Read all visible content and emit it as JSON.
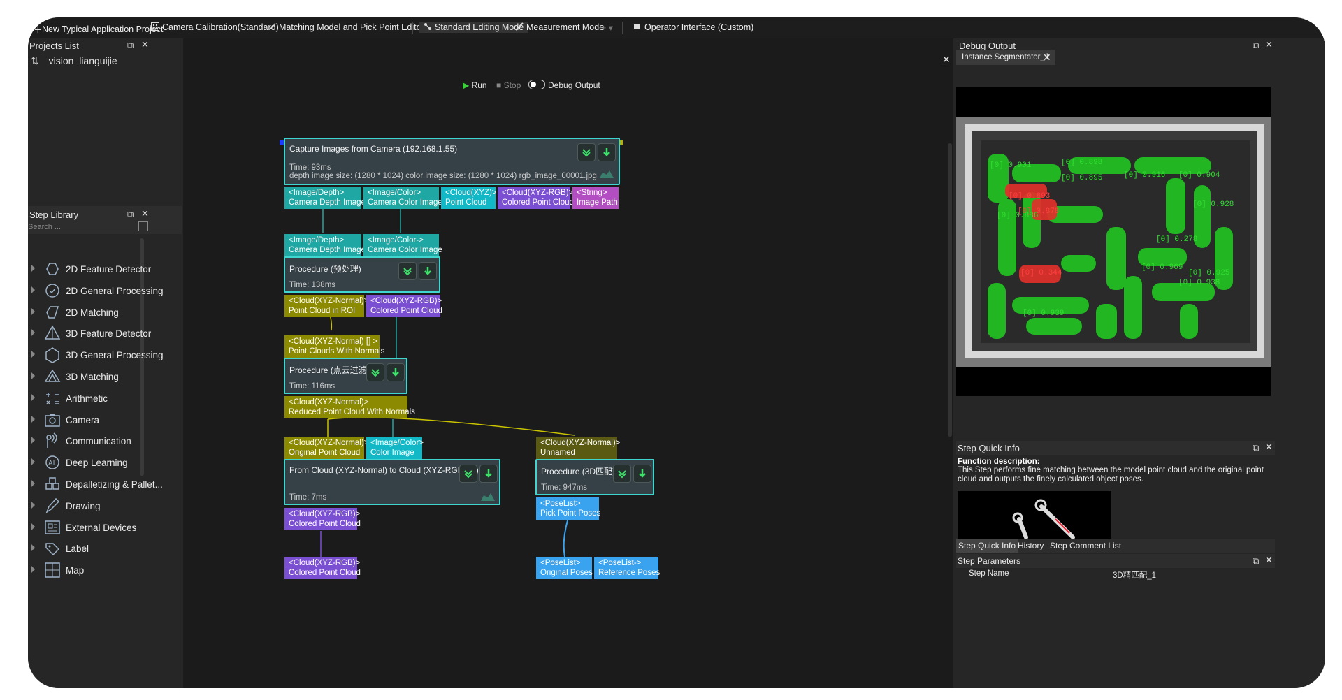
{
  "toolbar": {
    "new_project": "New Typical Application Project",
    "calibration": "Camera Calibration(Standard)",
    "matching_editor": "Matching Model and Pick Point Editor",
    "editing_mode": "Standard Editing Mode",
    "measurement_mode": "Measurement Mode",
    "operator_interface": "Operator Interface (Custom)"
  },
  "projects": {
    "title": "Projects List",
    "project_name": "vision_lianguijie"
  },
  "library": {
    "title": "Step Library",
    "search_placeholder": "Search ...",
    "items": [
      {
        "label": "2D Feature Detector",
        "icon": "feature-2d-icon"
      },
      {
        "label": "2D General Processing",
        "icon": "processing-2d-icon"
      },
      {
        "label": "2D Matching",
        "icon": "matching-2d-icon"
      },
      {
        "label": "3D Feature Detector",
        "icon": "feature-3d-icon"
      },
      {
        "label": "3D General Processing",
        "icon": "processing-3d-icon"
      },
      {
        "label": "3D Matching",
        "icon": "matching-3d-icon"
      },
      {
        "label": "Arithmetic",
        "icon": "arithmetic-icon"
      },
      {
        "label": "Camera",
        "icon": "camera-icon"
      },
      {
        "label": "Communication",
        "icon": "communication-icon"
      },
      {
        "label": "Deep Learning",
        "icon": "deep-learning-icon"
      },
      {
        "label": "Depalletizing & Pallet...",
        "icon": "depalletizing-icon"
      },
      {
        "label": "Drawing",
        "icon": "drawing-icon"
      },
      {
        "label": "External Devices",
        "icon": "external-devices-icon"
      },
      {
        "label": "Label",
        "icon": "label-icon"
      },
      {
        "label": "Map",
        "icon": "map-icon"
      }
    ]
  },
  "run_bar": {
    "run": "Run",
    "stop": "Stop",
    "debug": "Debug Output"
  },
  "graph": {
    "capture": {
      "title": "Capture Images from Camera (192.168.1.55)",
      "time": "Time: 93ms",
      "detail": "depth image size: (1280 * 1024)  color image size: (1280 * 1024)  rgb_image_00001.jpg",
      "ports": [
        {
          "type": "<Image/Depth>",
          "name": "Camera Depth Image"
        },
        {
          "type": "<Image/Color>",
          "name": "Camera Color Image"
        },
        {
          "type": "<Cloud(XYZ)>",
          "name": "Point Cloud"
        },
        {
          "type": "<Cloud(XYZ-RGB)>",
          "name": "Colored Point Cloud"
        },
        {
          "type": "<String>",
          "name": "Image Path"
        }
      ]
    },
    "proc1": {
      "inputs": [
        {
          "type": "<Image/Depth>",
          "name": "Camera Depth Image"
        },
        {
          "type": "<Image/Color->",
          "name": "Camera Color Image"
        }
      ],
      "title": "Procedure (预处理)",
      "time": "Time: 138ms",
      "outputs": [
        {
          "type": "<Cloud(XYZ-Normal)>",
          "name": "Point Cloud in ROI"
        },
        {
          "type": "<Cloud(XYZ-RGB)>",
          "name": "Colored Point Cloud"
        }
      ]
    },
    "proc2": {
      "input": {
        "type": "<Cloud(XYZ-Normal) [] >",
        "name": "Point Clouds With Normals"
      },
      "title": "Procedure (点云过滤)",
      "time": "Time: 116ms",
      "output": {
        "type": "<Cloud(XYZ-Normal)>",
        "name": "Reduced Point Cloud With Normals"
      }
    },
    "convert": {
      "inputs": [
        {
          "type": "<Cloud(XYZ-Normal)>",
          "name": "Original Point Cloud"
        },
        {
          "type": "<Image/Color>",
          "name": "Color Image"
        }
      ],
      "title": "From Cloud (XYZ-Normal) to Cloud (XYZ-RGB) (1)",
      "time": "Time: 7ms",
      "output": {
        "type": "<Cloud(XYZ-RGB)>",
        "name": "Colored Point Cloud"
      },
      "next_input": {
        "type": "<Cloud(XYZ-RGB)>",
        "name": "Colored Point Cloud"
      }
    },
    "match": {
      "input": {
        "type": "<Cloud(XYZ-Normal)>",
        "name": "Unnamed"
      },
      "title": "Procedure (3D匹配)",
      "time": "Time: 947ms",
      "output": {
        "type": "<PoseList>",
        "name": "Pick Point Poses"
      },
      "next_inputs": [
        {
          "type": "<PoseList>",
          "name": "Original Poses"
        },
        {
          "type": "<PoseList->",
          "name": "Reference Poses"
        }
      ]
    }
  },
  "debug": {
    "title": "Debug Output",
    "tab": "Instance Segmentator_1",
    "labels": [
      {
        "text": "[0] 0.901",
        "color": "#2fe02f"
      },
      {
        "text": "[0] 0.898",
        "color": "#2fe02f"
      },
      {
        "text": "[0] 0.895",
        "color": "#2fe02f"
      },
      {
        "text": "[0] 0.916",
        "color": "#2fe02f"
      },
      {
        "text": "[0] 0.904",
        "color": "#2fe02f"
      },
      {
        "text": "[0] 0.893",
        "color": "#ff4040"
      },
      {
        "text": "[0] 0.928",
        "color": "#2fe02f"
      },
      {
        "text": "[0] 0.878",
        "color": "#ff4040"
      },
      {
        "text": "[0] 0.886",
        "color": "#2fe02f"
      },
      {
        "text": "[0] 0.278",
        "color": "#2fe02f"
      },
      {
        "text": "[0] 0.344",
        "color": "#ff4040"
      },
      {
        "text": "[0] 0.969",
        "color": "#2fe02f"
      },
      {
        "text": "[0] 0.925",
        "color": "#2fe02f"
      },
      {
        "text": "[0] 0.938",
        "color": "#2fe02f"
      },
      {
        "text": "[0] 0.939",
        "color": "#2fe02f"
      }
    ]
  },
  "quick_info": {
    "title": "Step Quick Info",
    "func_label": "Function description:",
    "func_text": "This Step performs fine matching between the model point cloud and the original point cloud and outputs the finely calculated object poses.",
    "tabs": [
      "Step Quick Info",
      "History",
      "Step Comment List"
    ]
  },
  "params": {
    "title": "Step Parameters",
    "step_name_label": "Step Name",
    "step_name_value": "3D精匹配_1"
  },
  "colors": {
    "node_border": "#3fd6cf",
    "accent_green": "#2fe02f",
    "error_red": "#ff4040"
  }
}
